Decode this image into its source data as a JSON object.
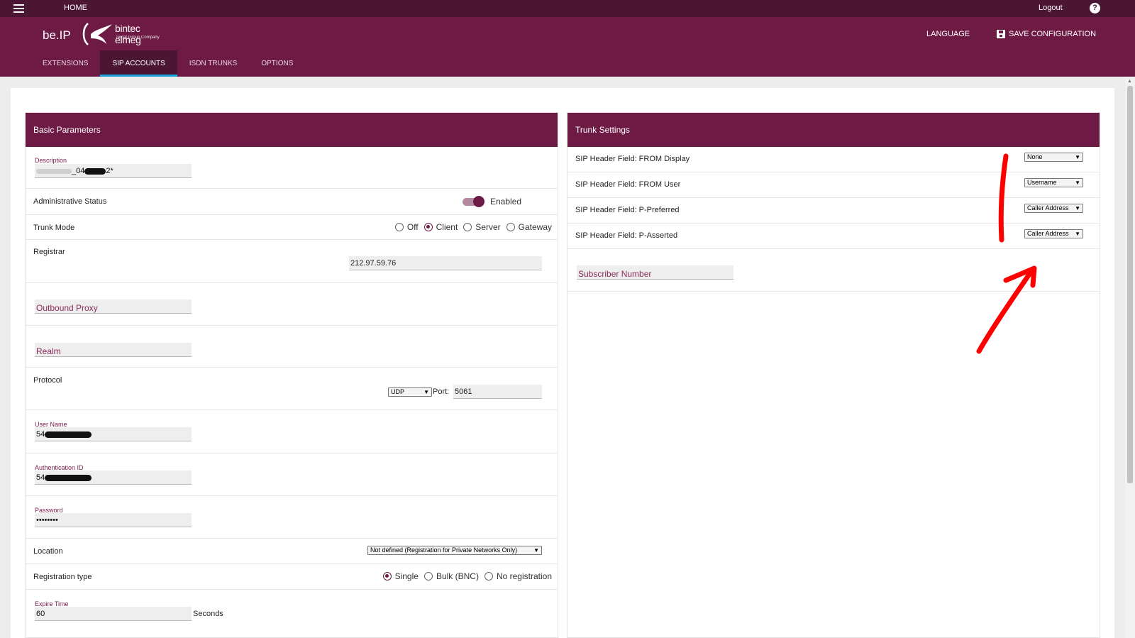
{
  "topbar": {
    "home": "HOME",
    "logout": "Logout",
    "help": "?"
  },
  "header": {
    "brand": "be.IP",
    "logo_word": "bintec elmeg",
    "logo_sub": "Teldat Group Company",
    "language": "LANGUAGE",
    "save": "SAVE CONFIGURATION"
  },
  "tabs": [
    "EXTENSIONS",
    "SIP ACCOUNTS",
    "ISDN TRUNKS",
    "OPTIONS"
  ],
  "left": {
    "title": "Basic Parameters",
    "description": {
      "label": "Description",
      "prefix": "_04",
      "suffix": "2*"
    },
    "admin_status": {
      "label": "Administrative Status",
      "value": "Enabled"
    },
    "trunk_mode": {
      "label": "Trunk Mode",
      "options": [
        "Off",
        "Client",
        "Server",
        "Gateway"
      ],
      "selected": "Client"
    },
    "registrar": {
      "label": "Registrar",
      "value": "212.97.59.76"
    },
    "outbound_proxy": {
      "placeholder": "Outbound Proxy"
    },
    "realm": {
      "placeholder": "Realm"
    },
    "protocol": {
      "label": "Protocol",
      "value": "UDP",
      "port_label": "Port:",
      "port": "5061"
    },
    "user_name": {
      "label": "User Name",
      "value": "54"
    },
    "auth_id": {
      "label": "Authentication ID",
      "value": "54"
    },
    "password": {
      "label": "Password",
      "value": "••••••••"
    },
    "location": {
      "label": "Location",
      "value": "Not defined (Registration for Private Networks Only)"
    },
    "reg_type": {
      "label": "Registration type",
      "options": [
        "Single",
        "Bulk (BNC)",
        "No registration"
      ],
      "selected": "Single"
    },
    "expire": {
      "label": "Expire Time",
      "value": "60",
      "unit": "Seconds"
    }
  },
  "right": {
    "title": "Trunk Settings",
    "fields": [
      {
        "label": "SIP Header Field: FROM Display",
        "value": "None"
      },
      {
        "label": "SIP Header Field: FROM User",
        "value": "Username"
      },
      {
        "label": "SIP Header Field: P-Preferred",
        "value": "Caller Address"
      },
      {
        "label": "SIP Header Field: P-Asserted",
        "value": "Caller Address"
      }
    ],
    "subscriber": {
      "placeholder": "Subscriber Number"
    }
  },
  "colors": {
    "primary": "#6d1a45",
    "topbar": "#4b1534",
    "tab_underline": "#19a0d8",
    "annotation": "#ff0000"
  }
}
